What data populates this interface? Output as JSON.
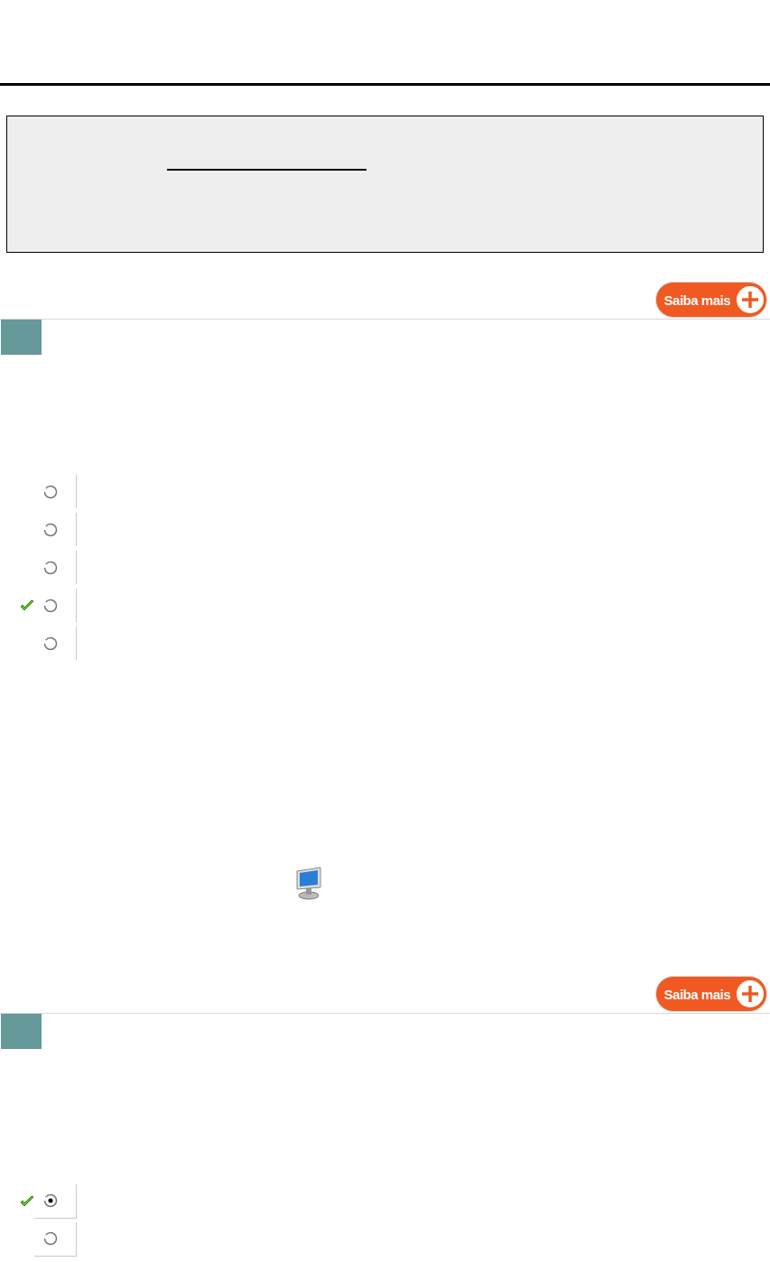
{
  "questions": [
    {
      "more_button": "Saiba mais",
      "options": [
        {
          "selected": false,
          "correct": false
        },
        {
          "selected": false,
          "correct": false
        },
        {
          "selected": false,
          "correct": false
        },
        {
          "selected": false,
          "correct": true
        },
        {
          "selected": false,
          "correct": false
        }
      ]
    },
    {
      "more_button": "Saiba mais",
      "options": [
        {
          "selected": true,
          "correct": true
        },
        {
          "selected": false,
          "correct": false
        }
      ]
    }
  ]
}
